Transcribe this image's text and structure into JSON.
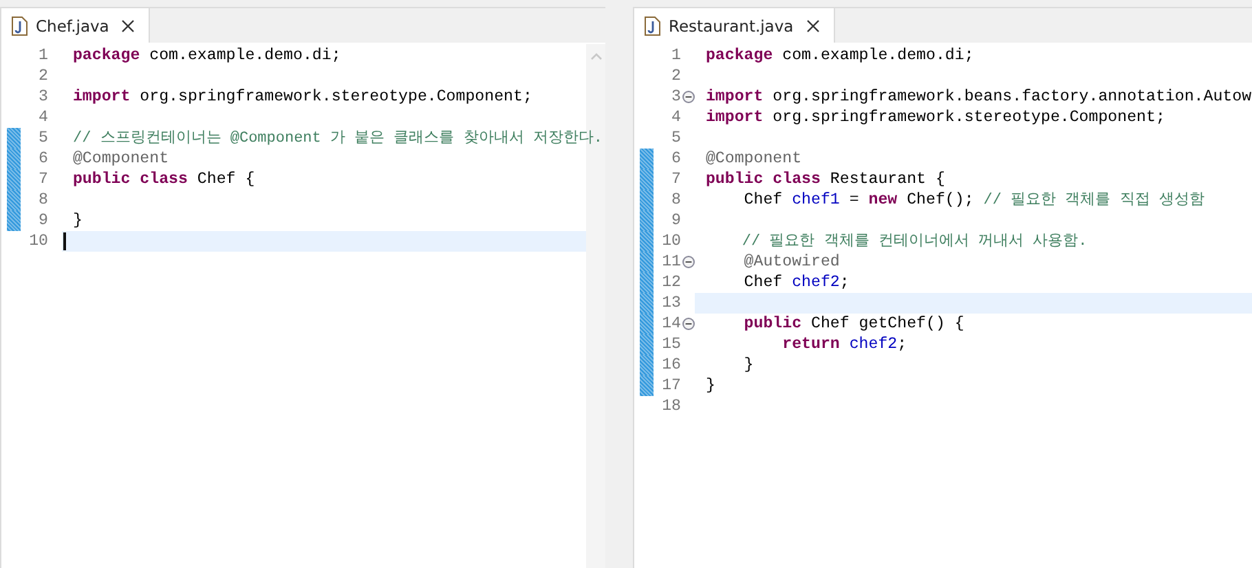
{
  "editors": [
    {
      "tab": {
        "label": "Chef.java"
      },
      "lines": [
        {
          "number": "1",
          "changed": false,
          "current": false,
          "fold": false,
          "caret": false,
          "tokens": [
            {
              "kind": "kw",
              "t": "package"
            },
            {
              "kind": "plain",
              "t": " com.example.demo.di;"
            }
          ]
        },
        {
          "number": "2",
          "changed": false,
          "current": false,
          "fold": false,
          "caret": false
        },
        {
          "number": "3",
          "changed": false,
          "current": false,
          "fold": false,
          "caret": false,
          "tokens": [
            {
              "kind": "kw",
              "t": "import"
            },
            {
              "kind": "plain",
              "t": " org.springframework.stereotype.Component;"
            }
          ]
        },
        {
          "number": "4",
          "changed": false,
          "current": false,
          "fold": false,
          "caret": false
        },
        {
          "number": "5",
          "changed": true,
          "current": false,
          "fold": false,
          "caret": false,
          "tokens": [
            {
              "kind": "comment",
              "t": "// 스프링컨테이너는 @Component 가 붙은 클래스를 찾아내서 저장한다."
            }
          ]
        },
        {
          "number": "6",
          "changed": true,
          "current": false,
          "fold": false,
          "caret": false,
          "tokens": [
            {
              "kind": "annotation",
              "t": "@Component"
            }
          ]
        },
        {
          "number": "7",
          "changed": true,
          "current": false,
          "fold": false,
          "caret": false,
          "tokens": [
            {
              "kind": "kw",
              "t": "public class"
            },
            {
              "kind": "plain",
              "t": " Chef {"
            }
          ]
        },
        {
          "number": "8",
          "changed": true,
          "current": false,
          "fold": false,
          "caret": false
        },
        {
          "number": "9",
          "changed": true,
          "current": false,
          "fold": false,
          "caret": false,
          "tokens": [
            {
              "kind": "plain",
              "t": "}"
            }
          ]
        },
        {
          "number": "10",
          "changed": false,
          "current": true,
          "fold": false,
          "caret": true
        }
      ]
    },
    {
      "tab": {
        "label": "Restaurant.java"
      },
      "lines": [
        {
          "number": "1",
          "changed": false,
          "current": false,
          "fold": false,
          "caret": false,
          "tokens": [
            {
              "kind": "kw",
              "t": "package"
            },
            {
              "kind": "plain",
              "t": " com.example.demo.di;"
            }
          ]
        },
        {
          "number": "2",
          "changed": false,
          "current": false,
          "fold": false,
          "caret": false
        },
        {
          "number": "3",
          "changed": false,
          "current": false,
          "fold": true,
          "caret": false,
          "tokens": [
            {
              "kind": "kw",
              "t": "import"
            },
            {
              "kind": "plain",
              "t": " org.springframework.beans.factory.annotation.Autow"
            }
          ]
        },
        {
          "number": "4",
          "changed": false,
          "current": false,
          "fold": false,
          "caret": false,
          "tokens": [
            {
              "kind": "kw",
              "t": "import"
            },
            {
              "kind": "plain",
              "t": " org.springframework.stereotype.Component;"
            }
          ]
        },
        {
          "number": "5",
          "changed": false,
          "current": false,
          "fold": false,
          "caret": false
        },
        {
          "number": "6",
          "changed": true,
          "current": false,
          "fold": false,
          "caret": false,
          "tokens": [
            {
              "kind": "annotation",
              "t": "@Component"
            }
          ]
        },
        {
          "number": "7",
          "changed": true,
          "current": false,
          "fold": false,
          "caret": false,
          "tokens": [
            {
              "kind": "kw",
              "t": "public class"
            },
            {
              "kind": "plain",
              "t": " Restaurant {"
            }
          ]
        },
        {
          "number": "8",
          "changed": true,
          "current": false,
          "fold": false,
          "caret": false,
          "tokens": [
            {
              "kind": "plain",
              "t": "    Chef "
            },
            {
              "kind": "field",
              "t": "chef1"
            },
            {
              "kind": "plain",
              "t": " = "
            },
            {
              "kind": "kw",
              "t": "new"
            },
            {
              "kind": "plain",
              "t": " Chef(); "
            },
            {
              "kind": "comment",
              "t": "// 필요한 객체를 직접 생성함"
            }
          ]
        },
        {
          "number": "9",
          "changed": true,
          "current": false,
          "fold": false,
          "caret": false
        },
        {
          "number": "10",
          "changed": true,
          "current": false,
          "fold": false,
          "caret": false,
          "tokens": [
            {
              "kind": "comment",
              "t": "    // 필요한 객체를 컨테이너에서 꺼내서 사용함."
            }
          ]
        },
        {
          "number": "11",
          "changed": true,
          "current": false,
          "fold": true,
          "caret": false,
          "tokens": [
            {
              "kind": "annotation",
              "t": "    @Autowired"
            }
          ]
        },
        {
          "number": "12",
          "changed": true,
          "current": false,
          "fold": false,
          "caret": false,
          "tokens": [
            {
              "kind": "plain",
              "t": "    Chef "
            },
            {
              "kind": "field",
              "t": "chef2"
            },
            {
              "kind": "plain",
              "t": ";"
            }
          ]
        },
        {
          "number": "13",
          "changed": true,
          "current": true,
          "fold": false,
          "caret": false
        },
        {
          "number": "14",
          "changed": true,
          "current": false,
          "fold": true,
          "caret": false,
          "tokens": [
            {
              "kind": "kw",
              "t": "    public"
            },
            {
              "kind": "plain",
              "t": " Chef getChef() {"
            }
          ]
        },
        {
          "number": "15",
          "changed": true,
          "current": false,
          "fold": false,
          "caret": false,
          "tokens": [
            {
              "kind": "kw",
              "t": "        return"
            },
            {
              "kind": "field",
              "t": " chef2"
            },
            {
              "kind": "plain",
              "t": ";"
            }
          ]
        },
        {
          "number": "16",
          "changed": true,
          "current": false,
          "fold": false,
          "caret": false,
          "tokens": [
            {
              "kind": "plain",
              "t": "    }"
            }
          ]
        },
        {
          "number": "17",
          "changed": true,
          "current": false,
          "fold": false,
          "caret": false,
          "tokens": [
            {
              "kind": "plain",
              "t": "}"
            }
          ]
        },
        {
          "number": "18",
          "changed": false,
          "current": false,
          "fold": false,
          "caret": false
        }
      ]
    }
  ]
}
